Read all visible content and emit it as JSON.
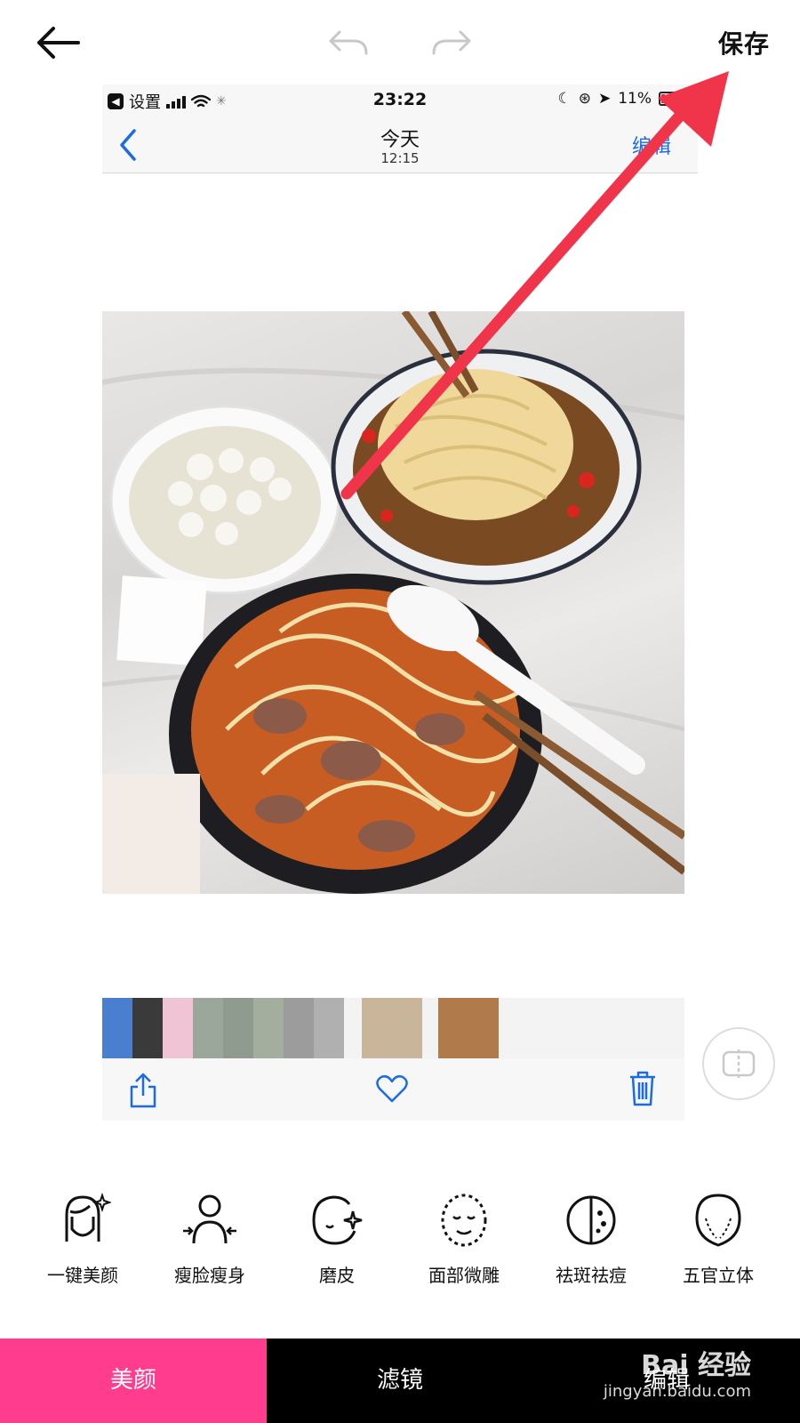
{
  "toolbar": {
    "save_label": "保存"
  },
  "ios_status": {
    "settings_label": "设置",
    "time": "23:22",
    "battery": "11%"
  },
  "ios_nav": {
    "title": "今天",
    "subtitle": "12:15",
    "edit_label": "编辑"
  },
  "tools": [
    {
      "label": "一键美颜",
      "icon": "one-key-beauty-icon"
    },
    {
      "label": "瘦脸瘦身",
      "icon": "slim-face-body-icon"
    },
    {
      "label": "磨皮",
      "icon": "smooth-skin-icon"
    },
    {
      "label": "面部微雕",
      "icon": "face-sculpt-icon"
    },
    {
      "label": "祛斑祛痘",
      "icon": "spot-removal-icon"
    },
    {
      "label": "五官立体",
      "icon": "facial-3d-icon"
    }
  ],
  "tabs": [
    {
      "label": "美颜",
      "active": true
    },
    {
      "label": "滤镜",
      "active": false
    },
    {
      "label": "编辑",
      "active": false
    }
  ],
  "watermark": {
    "main": "Bai 经验",
    "sub": "jingyan.baidu.com"
  },
  "colors": {
    "accent": "#ff3c8d",
    "tabbar": "#000000",
    "ios_blue": "#1a6be6",
    "arrow": "#f0344a"
  }
}
